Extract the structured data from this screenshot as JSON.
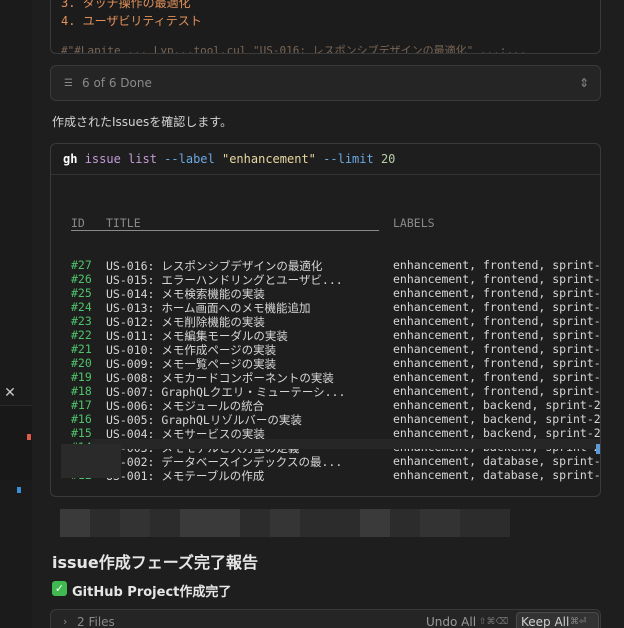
{
  "markdown_block": {
    "lines": [
      "3. タッチ操作の最適化",
      "4. ユーザビリティテスト"
    ],
    "cut_line": "#\"#Lapite ... Lyp...tool.cul \"US-016: レスポンシブデザインの最適化\" ...:..."
  },
  "todo": {
    "icon": "list-check-icon",
    "status": "6 of 6 Done"
  },
  "assistant_text": "作成されたIssuesを確認します。",
  "terminal": {
    "command": {
      "program": "gh",
      "subcommand": "issue list",
      "flag1": "--label",
      "value1": "\"enhancement\"",
      "flag2": "--limit",
      "value2": "20"
    },
    "headers": {
      "id": "ID",
      "title": "TITLE",
      "labels": "LABELS"
    },
    "rows": [
      {
        "id": "#27",
        "title": "US-016: レスポンシブデザインの最適化",
        "labels": "enhancement, frontend, sprint-"
      },
      {
        "id": "#26",
        "title": "US-015: エラーハンドリングとユーザビ...",
        "labels": "enhancement, frontend, sprint-"
      },
      {
        "id": "#25",
        "title": "US-014: メモ検索機能の実装",
        "labels": "enhancement, frontend, sprint-"
      },
      {
        "id": "#24",
        "title": "US-013: ホーム画面へのメモ機能追加",
        "labels": "enhancement, frontend, sprint-"
      },
      {
        "id": "#23",
        "title": "US-012: メモ削除機能の実装",
        "labels": "enhancement, frontend, sprint-"
      },
      {
        "id": "#22",
        "title": "US-011: メモ編集モーダルの実装",
        "labels": "enhancement, frontend, sprint-"
      },
      {
        "id": "#21",
        "title": "US-010: メモ作成ページの実装",
        "labels": "enhancement, frontend, sprint-"
      },
      {
        "id": "#20",
        "title": "US-009: メモ一覧ページの実装",
        "labels": "enhancement, frontend, sprint-"
      },
      {
        "id": "#19",
        "title": "US-008: メモカードコンポーネントの実装",
        "labels": "enhancement, frontend, sprint-"
      },
      {
        "id": "#18",
        "title": "US-007: GraphQLクエリ・ミューテーシ...",
        "labels": "enhancement, frontend, sprint-"
      },
      {
        "id": "#17",
        "title": "US-006: メモジュールの統合",
        "labels": "enhancement, backend, sprint-2"
      },
      {
        "id": "#16",
        "title": "US-005: GraphQLリゾルバーの実装",
        "labels": "enhancement, backend, sprint-2"
      },
      {
        "id": "#15",
        "title": "US-004: メモサービスの実装",
        "labels": "enhancement, backend, sprint-2"
      },
      {
        "id": "#14",
        "title": "US-003: メモモデルと入力型の定義",
        "labels": "enhancement, backend, sprint-2"
      },
      {
        "id": "#13",
        "title": "US-002: データベースインデックスの最...",
        "labels": "enhancement, database, sprint-"
      },
      {
        "id": "#12",
        "title": "US-001: メモテーブルの作成",
        "labels": "enhancement, database, sprint-"
      }
    ]
  },
  "report": {
    "heading": "issue作成フェーズ完了報告",
    "subheading_icon": "check-mark-icon",
    "subheading": "GitHub Project作成完了"
  },
  "files_bar": {
    "label": "2 Files",
    "undo_all": "Undo All",
    "undo_shortcut": "⇧⌘⌫",
    "keep_all": "Keep All",
    "keep_shortcut": "⌘⏎"
  },
  "colors": {
    "accent_green": "#4ec36a",
    "check_green": "#3fb950",
    "markdown_orange": "#e0905a"
  }
}
